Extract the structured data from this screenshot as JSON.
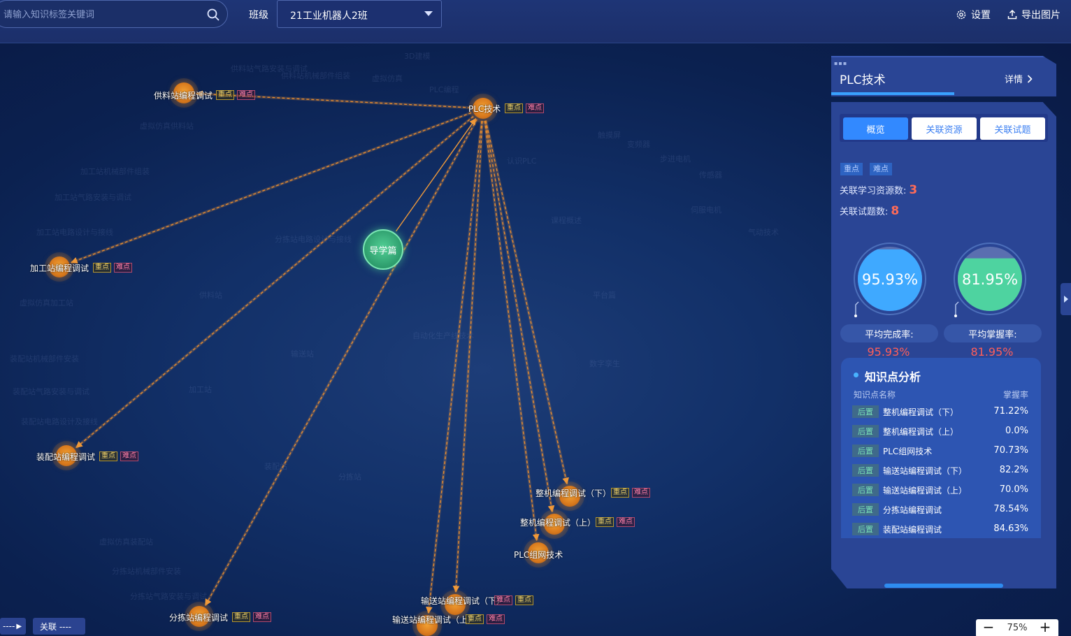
{
  "search": {
    "placeholder": "请输入知识标签关键词"
  },
  "class_filter": {
    "label": "班级",
    "selected": "21工业机器人2班"
  },
  "toolbar": {
    "settings_label": "设置",
    "export_label": "导出图片"
  },
  "graph": {
    "center_node": {
      "label": "PLC技术",
      "tag_key": "重点",
      "tag_diff": "难点"
    },
    "guide_node": {
      "label": "导学篇"
    },
    "nodes": [
      {
        "label": "供料站编程调试",
        "tags": [
          "重点",
          "难点"
        ]
      },
      {
        "label": "加工站编程调试",
        "tags": [
          "重点",
          "难点"
        ]
      },
      {
        "label": "装配站编程调试",
        "tags": [
          "重点",
          "难点"
        ]
      },
      {
        "label": "分拣站编程调试",
        "tags": [
          "重点",
          "难点"
        ]
      },
      {
        "label": "整机编程调试（下）",
        "tags": [
          "重点",
          "难点"
        ]
      },
      {
        "label": "整机编程调试（上）",
        "tags": [
          "重点",
          "难点"
        ]
      },
      {
        "label": "PLC组网技术",
        "tags": []
      },
      {
        "label": "输送站编程调试（下）",
        "tags": [
          "难点",
          "重点"
        ]
      },
      {
        "label": "输送站编程调试（上）",
        "tags": [
          "重点",
          "难点"
        ]
      }
    ],
    "faint_labels": [
      "供料站气路安装与调试",
      "供料站机械部件组装",
      "虚拟仿真供料站",
      "加工站机械部件组装",
      "加工站气路安装与调试",
      "加工站电路设计与接线",
      "虚拟仿真加工站",
      "装配站机械部件安装",
      "装配站气路安装与调试",
      "装配站电路设计及接线",
      "虚拟仿真装配站",
      "分拣站机械部件安装",
      "分拣站气路安装与调试",
      "分拣站电路设计与接线",
      "供料站",
      "加工站",
      "装配站",
      "分拣站",
      "输送站",
      "自动化生产线技术",
      "认识PLC",
      "课程概述",
      "平台篇",
      "数字孪生",
      "3D建模",
      "虚拟仿真",
      "PLC编程",
      "触摸屏",
      "变频器",
      "步进电机",
      "伺服电机",
      "传感器",
      "气动技术"
    ],
    "bottom_controls": {
      "left_btn": "----",
      "relation_btn": "关联 ----"
    },
    "zoom": "75%"
  },
  "panel": {
    "title": "PLC技术",
    "detail_label": "详情",
    "tabs": [
      "概览",
      "关联资源",
      "关联试题"
    ],
    "badges": [
      "重点",
      "难点"
    ],
    "resource_count_label": "关联学习资源数:",
    "resource_count": "3",
    "question_count_label": "关联试题数:",
    "question_count": "8",
    "gauges": [
      {
        "value_text": "95.93%",
        "value": 95.93,
        "label": "平均完成率:",
        "sub": "95.93%",
        "color": "#3fa9ff"
      },
      {
        "value_text": "81.95%",
        "value": 81.95,
        "label": "平均掌握率:",
        "sub": "81.95%",
        "color": "#4ed3a0"
      }
    ],
    "analysis": {
      "title": "知识点分析",
      "col_name": "知识点名称",
      "col_rate": "掌握率",
      "rows": [
        {
          "tag": "后置",
          "name": "整机编程调试（下）",
          "rate": "71.22%"
        },
        {
          "tag": "后置",
          "name": "整机编程调试（上）",
          "rate": "0.0%"
        },
        {
          "tag": "后置",
          "name": "PLC组网技术",
          "rate": "70.73%"
        },
        {
          "tag": "后置",
          "name": "输送站编程调试（下）",
          "rate": "82.2%"
        },
        {
          "tag": "后置",
          "name": "输送站编程调试（上）",
          "rate": "70.0%"
        },
        {
          "tag": "后置",
          "name": "分拣站编程调试",
          "rate": "78.54%"
        },
        {
          "tag": "后置",
          "name": "装配站编程调试",
          "rate": "84.63%"
        }
      ]
    }
  }
}
